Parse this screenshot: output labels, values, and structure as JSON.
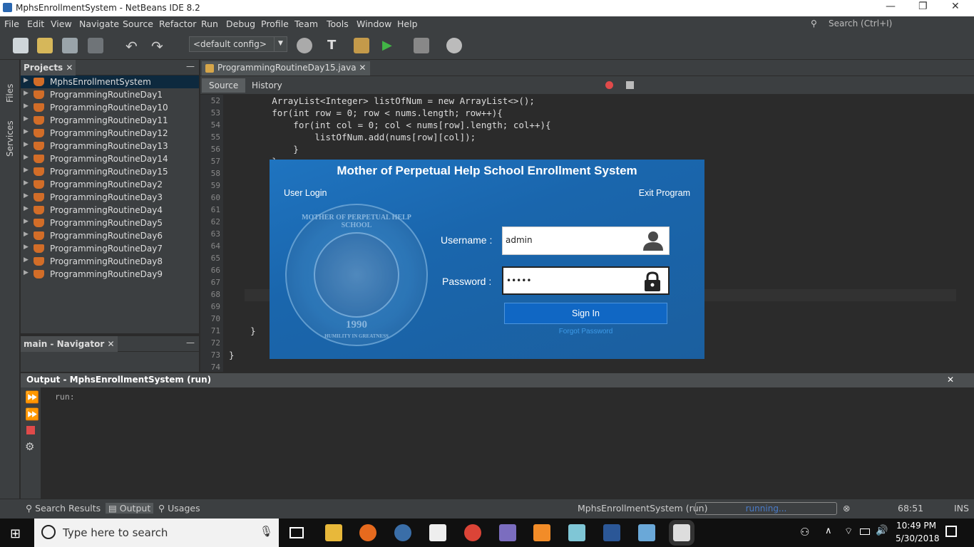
{
  "window": {
    "title": "MphsEnrollmentSystem - NetBeans IDE 8.2",
    "minimize": "—",
    "restore": "❐",
    "close": "✕"
  },
  "menu": [
    "File",
    "Edit",
    "View",
    "Navigate",
    "Source",
    "Refactor",
    "Run",
    "Debug",
    "Profile",
    "Team",
    "Tools",
    "Window",
    "Help"
  ],
  "toolbar": {
    "config": "<default config>"
  },
  "ide_search": {
    "placeholder": "Search (Ctrl+I)"
  },
  "side_tabs": {
    "files": "Files",
    "services": "Services"
  },
  "projects": {
    "tab": "Projects",
    "items": [
      "MphsEnrollmentSystem",
      "ProgrammingRoutineDay1",
      "ProgrammingRoutineDay10",
      "ProgrammingRoutineDay11",
      "ProgrammingRoutineDay12",
      "ProgrammingRoutineDay13",
      "ProgrammingRoutineDay14",
      "ProgrammingRoutineDay15",
      "ProgrammingRoutineDay2",
      "ProgrammingRoutineDay3",
      "ProgrammingRoutineDay4",
      "ProgrammingRoutineDay5",
      "ProgrammingRoutineDay6",
      "ProgrammingRoutineDay7",
      "ProgrammingRoutineDay8",
      "ProgrammingRoutineDay9"
    ]
  },
  "navigator": {
    "tab": "main - Navigator"
  },
  "editor": {
    "tab": "ProgrammingRoutineDay15.java",
    "source": "Source",
    "history": "History",
    "line_numbers": [
      "52",
      "53",
      "54",
      "55",
      "56",
      "57",
      "58",
      "59",
      "60",
      "61",
      "62",
      "63",
      "64",
      "65",
      "66",
      "67",
      "68",
      "69",
      "70",
      "71",
      "72",
      "73",
      "74"
    ],
    "code": [
      "        ArrayList<Integer> listOfNum = new ArrayList<>();",
      "        for(int row = 0; row < nums.length; row++){",
      "            for(int col = 0; col < nums[row].length; col++){",
      "                listOfNum.add(nums[row][col]);",
      "            }",
      "        }",
      "",
      "",
      "",
      "",
      "",
      "",
      "",
      "",
      "",
      "",
      "",
      "",
      "",
      "    }",
      "",
      "}",
      ""
    ]
  },
  "output": {
    "title": "Output - MphsEnrollmentSystem (run)",
    "text": "run:"
  },
  "statusbar": {
    "search_results": "Search Results",
    "output": "Output",
    "usages": "Usages",
    "project": "MphsEnrollmentSystem (run)",
    "progress": "running...",
    "position": "68:51",
    "mode": "INS"
  },
  "dialog": {
    "title": "Mother of Perpetual Help School Enrollment System",
    "user_login": "User Login",
    "exit": "Exit Program",
    "seal_top": "MOTHER OF PERPETUAL HELP SCHOOL",
    "seal_year": "1990",
    "seal_motto": "HUMILITY IN GREATNESS",
    "username_label": "Username :",
    "username_value": "admin",
    "password_label": "Password :",
    "password_value": "•••••",
    "signin": "Sign In",
    "forgot": "Forgot Password"
  },
  "taskbar": {
    "search_placeholder": "Type here to search",
    "time": "10:49 PM",
    "date": "5/30/2018"
  }
}
